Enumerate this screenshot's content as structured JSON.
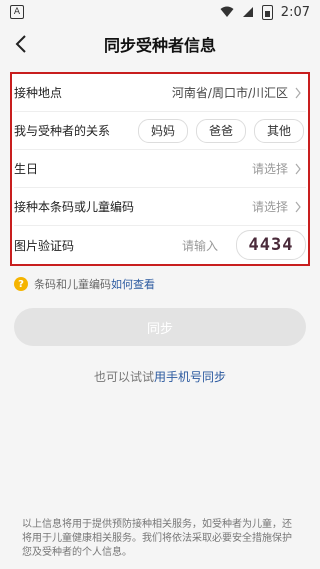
{
  "status": {
    "time": "2:07",
    "left_badge": "A"
  },
  "header": {
    "title": "同步受种者信息"
  },
  "form": {
    "location_label": "接种地点",
    "location_value": "河南省/周口市/川汇区",
    "relation_label": "我与受种者的关系",
    "relations": [
      "妈妈",
      "爸爸",
      "其他"
    ],
    "birthday_label": "生日",
    "birthday_placeholder": "请选择",
    "barcode_label": "接种本条码或儿童编码",
    "barcode_placeholder": "请选择",
    "captcha_label": "图片验证码",
    "captcha_placeholder": "请输入",
    "captcha_code": "4434"
  },
  "hint": {
    "text": "条码和儿童编码",
    "link": "如何查看"
  },
  "sync_button": "同步",
  "alt": {
    "text": "也可以试试",
    "link": "用手机号同步"
  },
  "disclaimer": "以上信息将用于提供预防接种相关服务，如受种者为儿童，还将用于儿童健康相关服务。我们将依法采取必要安全措施保护您及受种者的个人信息。",
  "colors": {
    "accent_link": "#2c5aa0",
    "highlight_border": "#c81e1e",
    "hint_icon": "#f5b400"
  }
}
